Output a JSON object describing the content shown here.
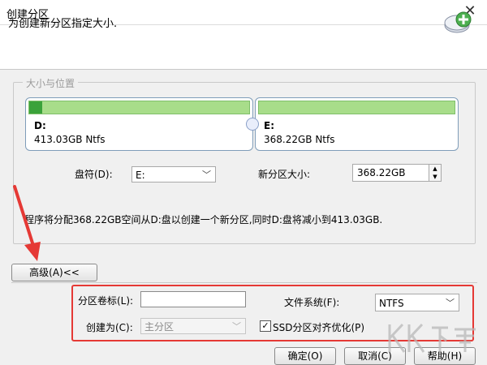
{
  "window": {
    "title": "创建分区"
  },
  "header": {
    "text": "为创建新分区指定大小."
  },
  "group": {
    "legend": "大小与位置"
  },
  "partitions": [
    {
      "name": "D:",
      "info": "413.03GB Ntfs",
      "usage": 0.06
    },
    {
      "name": "E:",
      "info": "368.22GB Ntfs",
      "usage": 0
    }
  ],
  "drive_letter": {
    "label": "盘符(D):",
    "value": "E:"
  },
  "new_size": {
    "label": "新分区大小:",
    "value": "368.22GB"
  },
  "description": "程序将分配368.22GB空间从D:盘以创建一个新分区,同时D:盘将减小到413.03GB.",
  "advanced_button": "高级(A)<<",
  "advanced": {
    "volume_label": {
      "label": "分区卷标(L):",
      "value": ""
    },
    "file_system": {
      "label": "文件系统(F):",
      "value": "NTFS"
    },
    "create_as": {
      "label": "创建为(C):",
      "value": "主分区"
    },
    "ssd_align": {
      "label": "SSD分区对齐优化(P)",
      "checked": true
    }
  },
  "buttons": {
    "ok": "确定(O)",
    "cancel": "取消(C)",
    "help": "帮助(H)"
  },
  "watermark": "KK下载",
  "colors": {
    "highlight": "#e53935",
    "bar_green": "#a8dd8a",
    "bar_dark": "#3aa23a"
  }
}
